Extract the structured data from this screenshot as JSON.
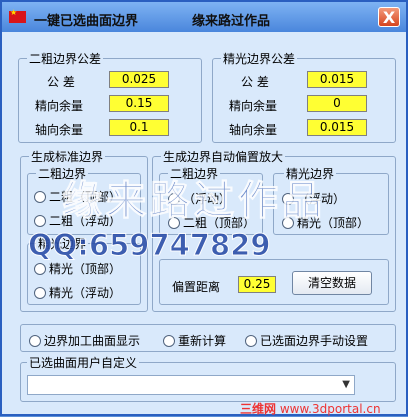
{
  "window": {
    "title": "一键已选曲面边界",
    "author": "缘来路过作品",
    "close_glyph": "X"
  },
  "rough_tolerance": {
    "legend": "二粗边界公差",
    "rows": [
      {
        "label": "公 差",
        "value": "0.025"
      },
      {
        "label": "精向余量",
        "value": "0.15"
      },
      {
        "label": "轴向余量",
        "value": "0.1"
      }
    ]
  },
  "finish_tolerance": {
    "legend": "精光边界公差",
    "rows": [
      {
        "label": "公 差",
        "value": "0.015"
      },
      {
        "label": "精向余量",
        "value": "0"
      },
      {
        "label": "轴向余量",
        "value": "0.015"
      }
    ]
  },
  "std_boundary": {
    "legend": "生成标准边界",
    "rough": {
      "legend": "二粗边界",
      "options": [
        "二粗（顶部）",
        "二粗（浮动）"
      ]
    },
    "finish": {
      "legend": "精光边界",
      "options": [
        "精光（顶部）",
        "精光（浮动）"
      ]
    }
  },
  "auto_offset": {
    "legend": "生成边界自动偏置放大",
    "rough": {
      "legend": "二粗边界",
      "options": [
        "（浮动）",
        "二粗（顶部）"
      ]
    },
    "finish": {
      "legend": "精光边界",
      "options": [
        "（浮动）",
        "精光（顶部）"
      ]
    },
    "offset_label": "偏置距离",
    "offset_value": "0.25",
    "clear_button": "清空数据"
  },
  "actions": {
    "options": [
      "边界加工曲面显示",
      "重新计算",
      "已选面边界手动设置"
    ]
  },
  "custom": {
    "legend": "已选曲面用户自定义",
    "value": ""
  },
  "watermark": {
    "big": "缘来路过作品",
    "qq": "QQ:659747829",
    "site_cn": "三维网",
    "site_url": "www.3dportal.cn"
  }
}
